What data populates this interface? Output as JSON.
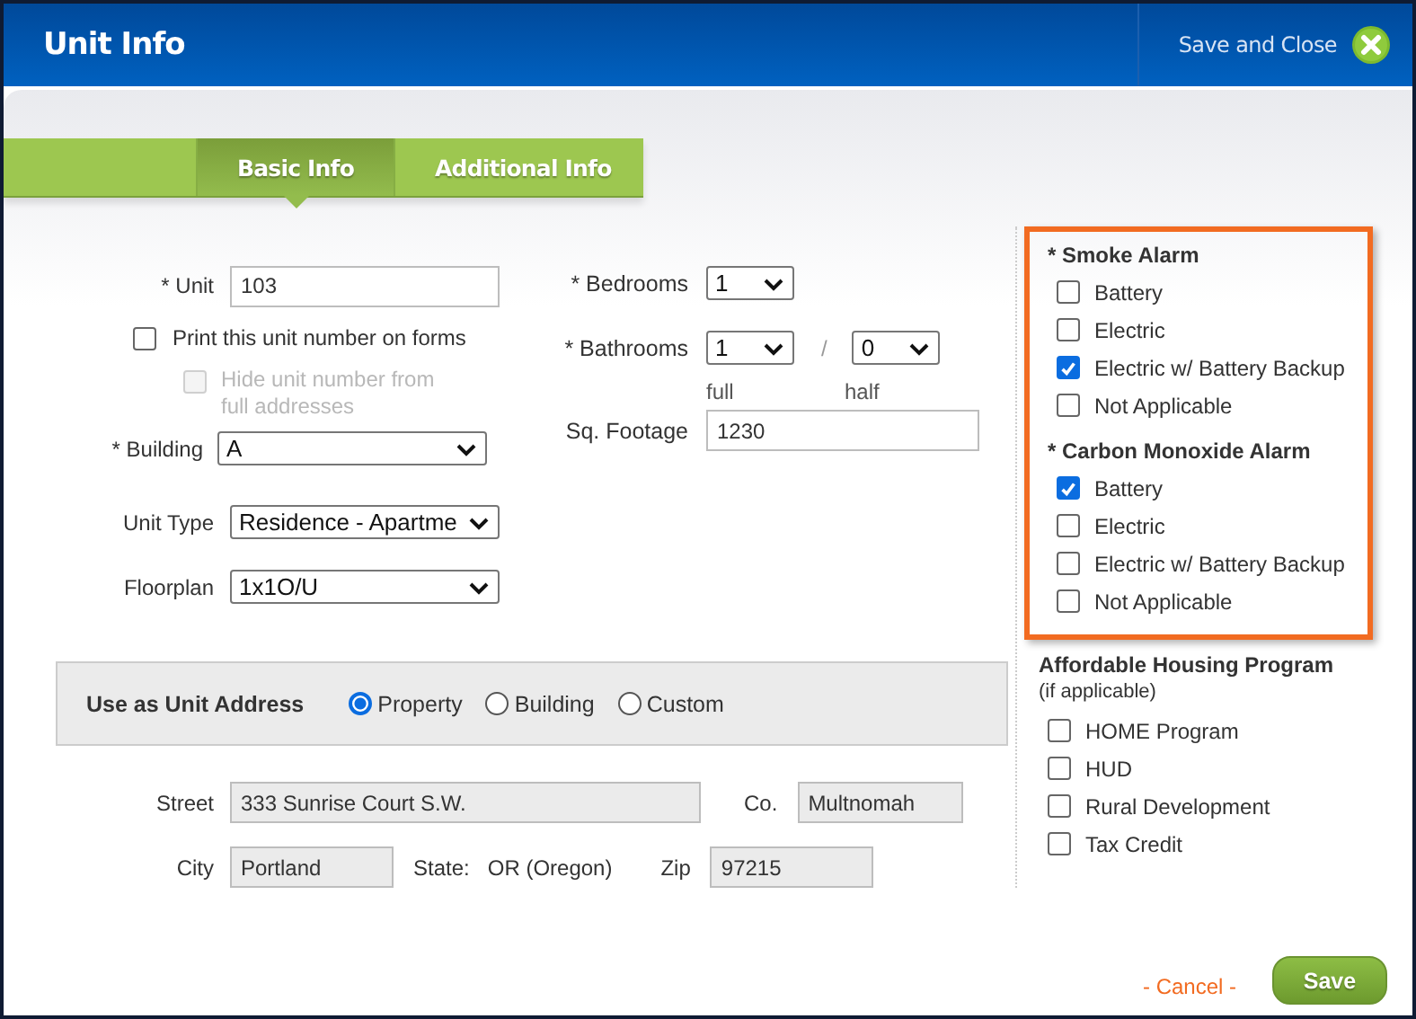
{
  "header": {
    "title": "Unit Info",
    "save_and_close": "Save and Close"
  },
  "tabs": [
    {
      "label": "Basic Info",
      "selected": true
    },
    {
      "label": "Additional Info",
      "selected": false
    }
  ],
  "unit": {
    "label": "* Unit",
    "value": "103"
  },
  "print_on_forms": {
    "label": "Print this unit number on forms",
    "checked": false
  },
  "hide_unit": {
    "label": "Hide unit number from full addresses",
    "checked": false,
    "disabled": true
  },
  "building": {
    "label": "* Building",
    "value": "A"
  },
  "unit_type": {
    "label": "Unit Type",
    "value": "Residence - Apartme"
  },
  "floorplan": {
    "label": "Floorplan",
    "value": "1x1O/U"
  },
  "bedrooms": {
    "label": "* Bedrooms",
    "value": "1"
  },
  "bathrooms": {
    "label": "* Bathrooms",
    "full": "1",
    "separator": "/",
    "half": "0",
    "full_caption": "full",
    "half_caption": "half"
  },
  "sq_footage": {
    "label": "Sq. Footage",
    "value": "1230"
  },
  "unit_address": {
    "label": "Use as Unit Address",
    "options": [
      {
        "label": "Property",
        "selected": true
      },
      {
        "label": "Building",
        "selected": false
      },
      {
        "label": "Custom",
        "selected": false
      }
    ]
  },
  "street": {
    "label": "Street",
    "value": "333 Sunrise Court S.W."
  },
  "county": {
    "label": "Co.",
    "value": "Multnomah"
  },
  "city": {
    "label": "City",
    "value": "Portland"
  },
  "state": {
    "label": "State:",
    "value": "OR (Oregon)"
  },
  "zip": {
    "label": "Zip",
    "value": "97215"
  },
  "alarms": {
    "highlighted": true,
    "groups": [
      {
        "title": "* Smoke Alarm",
        "options": [
          {
            "label": "Battery",
            "checked": false
          },
          {
            "label": "Electric",
            "checked": false
          },
          {
            "label": "Electric w/ Battery Backup",
            "checked": true
          },
          {
            "label": "Not Applicable",
            "checked": false
          }
        ]
      },
      {
        "title": "* Carbon Monoxide Alarm",
        "options": [
          {
            "label": "Battery",
            "checked": true
          },
          {
            "label": "Electric",
            "checked": false
          },
          {
            "label": "Electric w/ Battery Backup",
            "checked": false
          },
          {
            "label": "Not Applicable",
            "checked": false
          }
        ]
      }
    ]
  },
  "affordable_housing": {
    "title": "Affordable Housing Program",
    "note": "(if applicable)",
    "options": [
      {
        "label": "HOME Program",
        "checked": false
      },
      {
        "label": "HUD",
        "checked": false
      },
      {
        "label": "Rural Development",
        "checked": false
      },
      {
        "label": "Tax Credit",
        "checked": false
      }
    ]
  },
  "footer": {
    "cancel": "- Cancel -",
    "save": "Save"
  }
}
